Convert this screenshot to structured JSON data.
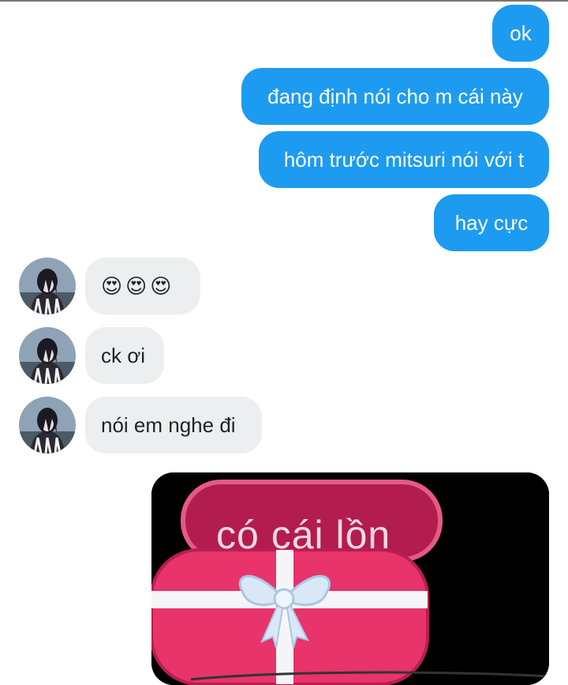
{
  "messages": {
    "outgoing": [
      "ok",
      "đang định nói cho m cái này",
      "hôm trước mitsuri nói với t",
      "hay cực"
    ],
    "incoming_emoji": "😍",
    "incoming": [
      "ck ơi",
      "nói em nghe đi"
    ]
  },
  "sticker": {
    "text": "có cái lồn"
  },
  "colors": {
    "outgoing_bubble": "#1d9bf0",
    "incoming_bubble": "#eceef0",
    "sticker_pink": "#e8336b"
  }
}
